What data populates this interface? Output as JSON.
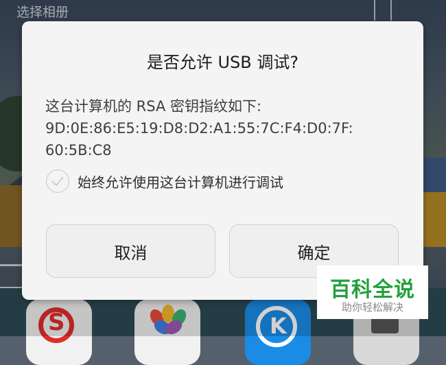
{
  "background": {
    "screen_title": "选择相册"
  },
  "dialog": {
    "title": "是否允许 USB 调试?",
    "message_line1": "这台计算机的 RSA 密钥指纹如下:",
    "fingerprint_line1": "9D:0E:86:E5:19:D8:D2:A1:55:7C:F4:D0:7F:",
    "fingerprint_line2": "60:5B:C8",
    "always_allow_label": "始终允许使用这台计算机进行调试",
    "always_allow_checked": false,
    "cancel_label": "取消",
    "ok_label": "确定"
  },
  "dock": {
    "apps": [
      {
        "icon": "sohu-app-icon",
        "glyph": "S"
      },
      {
        "icon": "photos-app-icon"
      },
      {
        "icon": "kugou-app-icon",
        "glyph": "K"
      },
      {
        "icon": "generic-app-icon"
      }
    ]
  },
  "watermark": {
    "main": "百科全说",
    "sub": "助你轻松解决"
  },
  "colors": {
    "dialog_bg": "#f4f4f4",
    "watermark_green": "#22a03c",
    "sohu_red": "#e12c2c",
    "kugou_blue": "#1a8ce6"
  }
}
